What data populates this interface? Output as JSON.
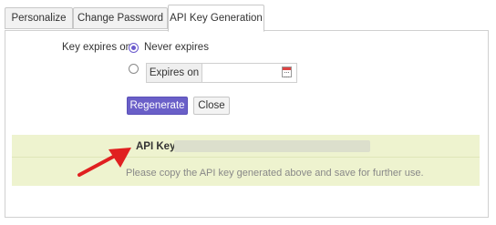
{
  "tabs": [
    {
      "label": "Personalize",
      "active": false
    },
    {
      "label": "Change Password",
      "active": false
    },
    {
      "label": "API Key Generation",
      "active": true
    }
  ],
  "form": {
    "expires_label": "Key expires on",
    "option_never": "Never expires",
    "option_never_selected": true,
    "option_date_selected": false,
    "expires_on_label": "Expires on",
    "expires_on_value": "",
    "calendar_icon": "calendar-icon",
    "regenerate_label": "Regenerate",
    "close_label": "Close"
  },
  "result": {
    "api_key_label": "API Key :",
    "api_key_value": "",
    "note": "Please copy the API key generated above and save for further use.",
    "annotation_icon": "red-arrow-icon"
  },
  "colors": {
    "accent": "#6a5fc8",
    "result_bg": "#eef3cf",
    "annotation": "#e02020"
  }
}
